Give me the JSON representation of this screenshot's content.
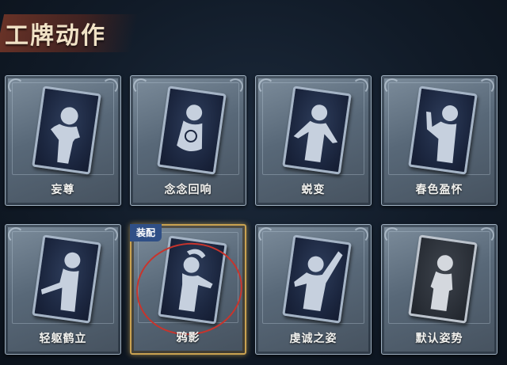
{
  "page": {
    "title": "工牌动作"
  },
  "cards": [
    {
      "label": "妄尊",
      "equipped": false
    },
    {
      "label": "念念回响",
      "equipped": false
    },
    {
      "label": "蜕变",
      "equipped": false
    },
    {
      "label": "春色盈怀",
      "equipped": false
    },
    {
      "label": "轻躯鹤立",
      "equipped": false
    },
    {
      "label": "鸦影",
      "equipped": true,
      "tag": "装配"
    },
    {
      "label": "虔诚之姿",
      "equipped": false
    },
    {
      "label": "默认姿势",
      "equipped": false
    }
  ],
  "colors": {
    "equipped_border": "#c9a251",
    "equip_tag": "#2f4f86",
    "mark": "#c8342c",
    "title": "#f1e2c6"
  }
}
